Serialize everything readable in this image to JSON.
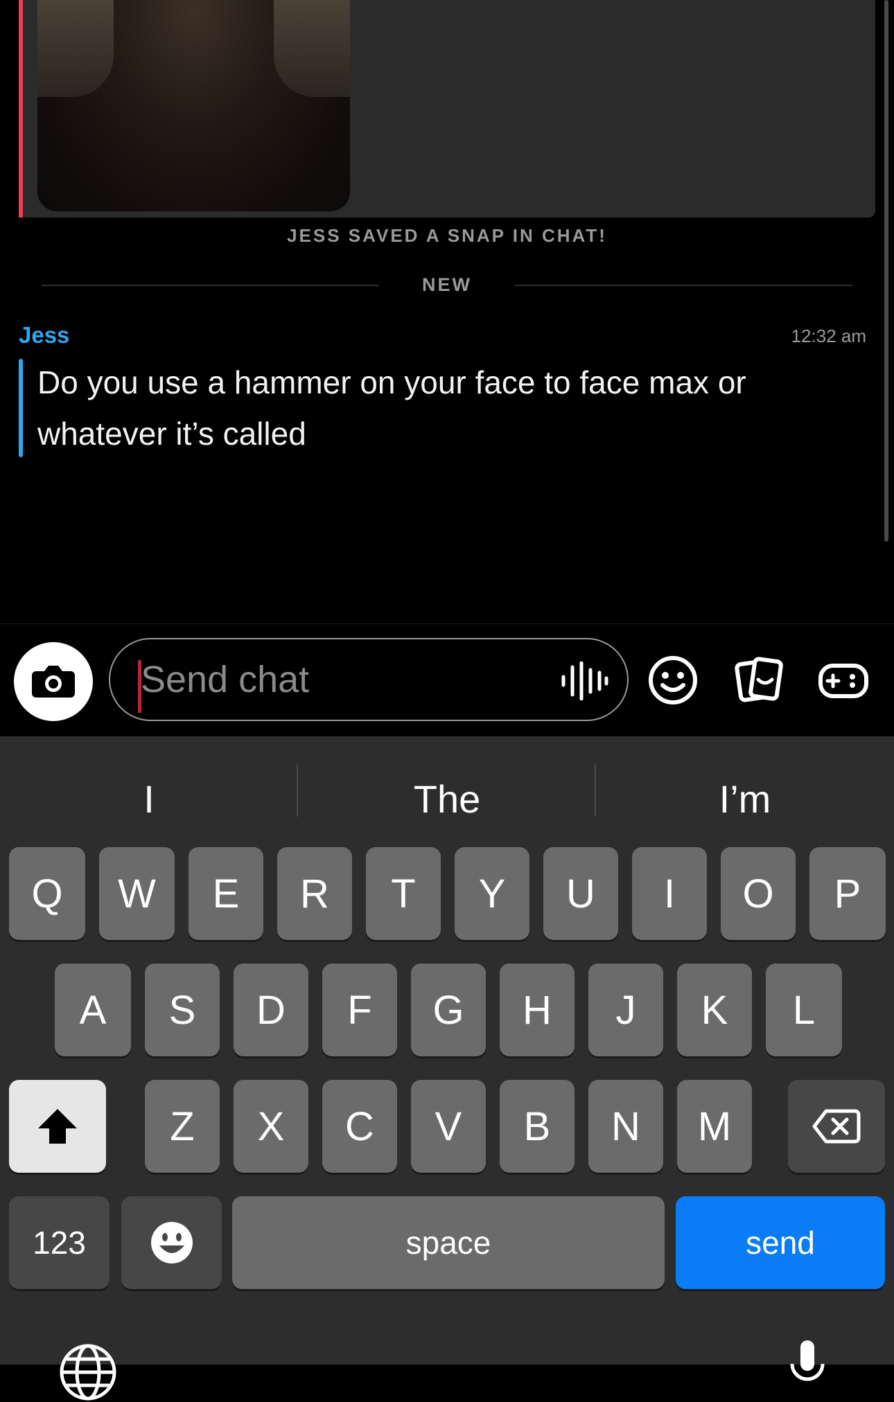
{
  "chat": {
    "saved_notice": "JESS SAVED A SNAP IN CHAT!",
    "new_label": "NEW",
    "message": {
      "sender": "Jess",
      "time": "12:32 am",
      "text": "Do you use a hammer on your face to face max or whatever it’s called"
    }
  },
  "composer": {
    "placeholder": "Send chat",
    "icons": [
      "camera-icon",
      "voice-icon",
      "emoji-icon",
      "stickers-icon",
      "game-controller-icon"
    ]
  },
  "keyboard": {
    "suggestions": [
      "I",
      "The",
      "I’m"
    ],
    "row1": [
      "Q",
      "W",
      "E",
      "R",
      "T",
      "Y",
      "U",
      "I",
      "O",
      "P"
    ],
    "row2": [
      "A",
      "S",
      "D",
      "F",
      "G",
      "H",
      "J",
      "K",
      "L"
    ],
    "row3": [
      "Z",
      "X",
      "C",
      "V",
      "B",
      "N",
      "M"
    ],
    "numbers_label": "123",
    "space_label": "space",
    "send_label": "send",
    "icons": [
      "shift-icon",
      "backspace-icon",
      "emoji-icon",
      "globe-icon",
      "microphone-icon"
    ],
    "colors": {
      "send": "#0a7cf5",
      "background": "#2d2d2d",
      "key": "#6b6b6b"
    }
  },
  "colors": {
    "sender": "#2fa6ee",
    "snap_bar": "#f23c57"
  }
}
